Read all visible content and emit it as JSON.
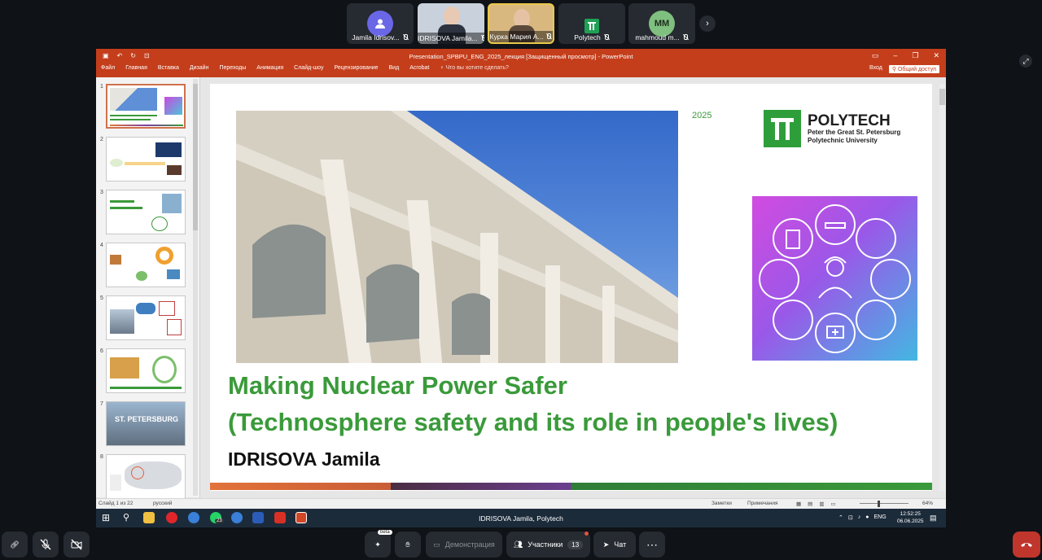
{
  "participants": [
    {
      "name": "Jamila Idrisov...",
      "initials": "",
      "color": "#6a67e6"
    },
    {
      "name": "IDRISOVA Jamila...",
      "initials": "",
      "color": "#c9d2dc"
    },
    {
      "name": "Курка Мария А...",
      "initials": "",
      "color": "#d9b880"
    },
    {
      "name": "Polytech",
      "initials": "",
      "color": "#1fa055"
    },
    {
      "name": "mahmoud m...",
      "initials": "MM",
      "color": "#7fbf7f"
    }
  ],
  "ppt": {
    "window_title": "Presentation_SPBPU_ENG_2025_лекция [Защищенный просмотр] - PowerPoint",
    "menu": [
      "Файл",
      "Главная",
      "Вставка",
      "Дизайн",
      "Переходы",
      "Анимация",
      "Слайд-шоу",
      "Рецензирование",
      "Вид",
      "Acrobat"
    ],
    "search_placeholder": "Что вы хотите сделать?",
    "signin": "Вход",
    "share": "Общий доступ",
    "slide_numbers": [
      "1",
      "2",
      "3",
      "4",
      "5",
      "6",
      "7",
      "8"
    ],
    "thumb7_text": "ST. PETERSBURG",
    "status_left": "Слайд 1 из 22",
    "status_lang": "русский",
    "notes_label": "Заметки",
    "comments_label": "Примечания",
    "zoom": "64%"
  },
  "slide": {
    "year": "2025",
    "logo_name": "POLYTECH",
    "logo_sub1": "Peter the Great St. Petersburg",
    "logo_sub2": "Polytechnic University",
    "title_line1": "Making Nuclear Power Safer",
    "title_line2": "(Technosphere safety and its role in people's lives)",
    "author": "IDRISOVA Jamila"
  },
  "taskbar": {
    "center_text": "IDRISOVA Jamila, Polytech",
    "lang": "ENG",
    "time": "12:52:25",
    "date": "06.06.2025",
    "whatsapp_badge": "23"
  },
  "controls": {
    "beta_label": "beta",
    "demo_label": "Демонстрация",
    "participants_label": "Участники",
    "participants_count": "13",
    "chat_label": "Чат"
  },
  "colors": {
    "accent_green": "#3a9a3a",
    "ppt_red": "#c43e1c",
    "leave_red": "#c0362c"
  }
}
